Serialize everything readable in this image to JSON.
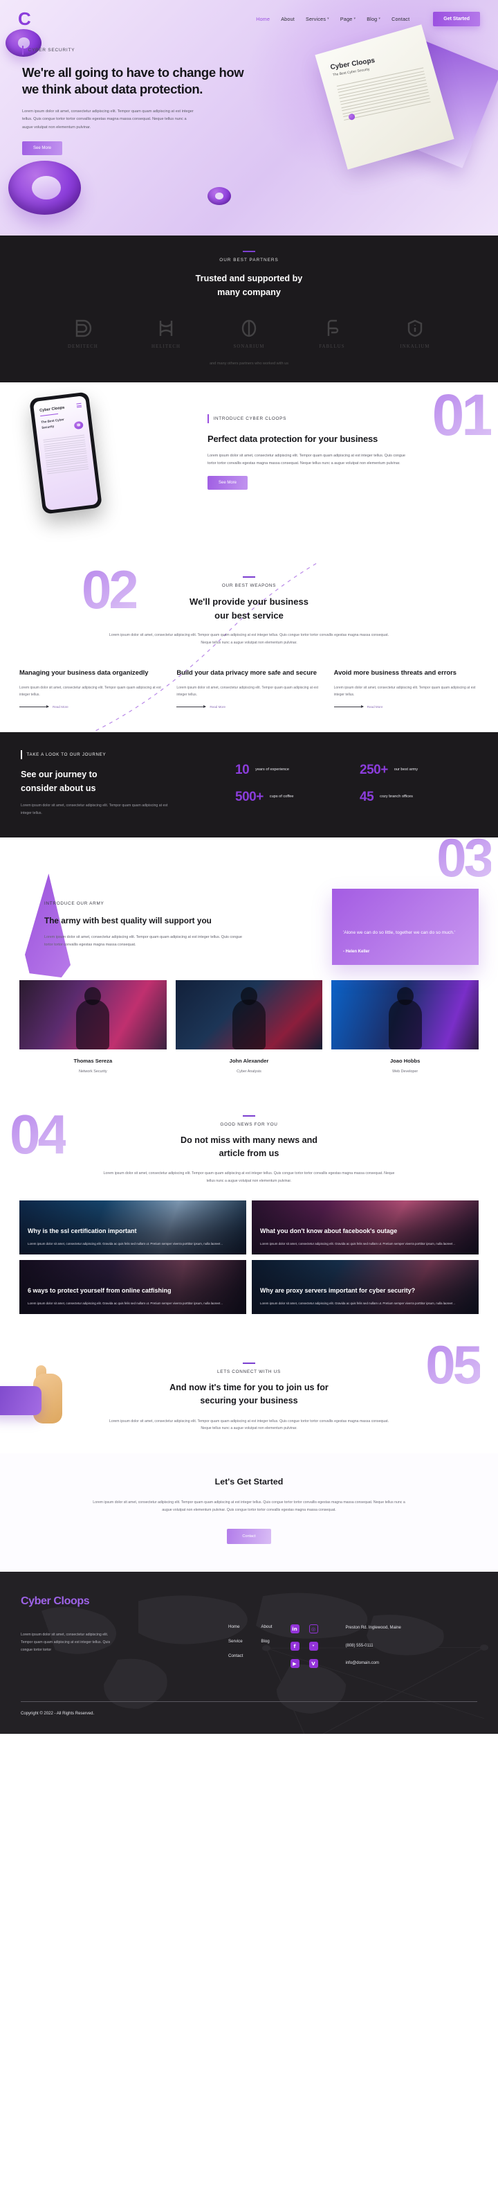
{
  "brand": {
    "name": "Cyber Cloops",
    "logo_glyph": "C"
  },
  "nav": {
    "items": [
      {
        "label": "Home",
        "active": true,
        "caret": ""
      },
      {
        "label": "About",
        "active": false,
        "caret": ""
      },
      {
        "label": "Services",
        "active": false,
        "caret": "▾"
      },
      {
        "label": "Page",
        "active": false,
        "caret": "▾"
      },
      {
        "label": "Blog",
        "active": false,
        "caret": "▾"
      },
      {
        "label": "Contact",
        "active": false,
        "caret": ""
      }
    ],
    "cta": "Get Started"
  },
  "hero": {
    "eyebrow": "CYBER SECURITY",
    "title": "We're all going to have to change how we think about data protection.",
    "paragraph": "Lorem ipsum dolor sit amet, consectetur adipiscing elit. Tempor quam quam adipiscing at est integer tellus. Quis congue tortor tortor convallis egestas magna massa consequat. Neque tellus nunc a augue volutpat non elementum pulvinar.",
    "button": "See More",
    "doc_title": "Cyber Cloops",
    "doc_sub": "The Best Cyber Security"
  },
  "partners": {
    "eyebrow": "OUR BEST PARTNERS",
    "title_line1": "Trusted and supported by",
    "title_line2": "many company",
    "note": "and many others partners who worked with us",
    "items": [
      {
        "name": "DEMITECH",
        "icon": "demitech-logo-icon"
      },
      {
        "name": "HELITECH",
        "icon": "helitech-logo-icon"
      },
      {
        "name": "SONARIUM",
        "icon": "sonarium-logo-icon"
      },
      {
        "name": "FABLLUS",
        "icon": "fabllus-logo-icon"
      },
      {
        "name": "INKALIUM",
        "icon": "inkalium-logo-icon"
      }
    ]
  },
  "section01": {
    "number": "01",
    "eyebrow": "INTRODUCE CYBER CLOOPS",
    "title": "Perfect data protection for your business",
    "paragraph": "Lorem ipsum dolor sit amet, consectetur adipiscing elit. Tempor quam quam adipiscing at est integer tellus. Quis congue tortor tortor convallis egestas magna massa consequat. Neque tellus nunc a augue volutpat non elementum pulvinar.",
    "button": "See More",
    "phone_logo": "Cyber Cloops",
    "phone_sub": "The Best Cyber Security"
  },
  "section02": {
    "number": "02",
    "eyebrow": "OUR BEST WEAPONS",
    "title_line1": "We'll provide your business",
    "title_line2": "our best service",
    "paragraph": "Lorem ipsum dolor sit amet, consectetur adipiscing elit. Tempor quam quam adipiscing at est integer tellus. Quis congue tortor tortor convallis egestas magna massa consequat. Neque tellus nunc a augue volutpat non elementum pulvinar.",
    "cards": [
      {
        "title": "Managing your business data organizedly",
        "body": "Lorem ipsum dolor sit amet, consectetur adipiscing elit. Tempor quam quam adipiscing at est integer tellus.",
        "link": "Read More"
      },
      {
        "title": "Build your data privacy more safe and secure",
        "body": "Lorem ipsum dolor sit amet, consectetur adipiscing elit. Tempor quam quam adipiscing at est integer tellus.",
        "link": "Read More"
      },
      {
        "title": "Avoid more business threats and errors",
        "body": "Lorem ipsum dolor sit amet, consectetur adipiscing elit. Tempor quam quam adipiscing at est integer tellus.",
        "link": "Read More"
      }
    ]
  },
  "stats": {
    "eyebrow": "TAKE A LOOK TO OUR JOURNEY",
    "title_line1": "See our journey to",
    "title_line2": "consider about us",
    "paragraph": "Lorem ipsum dolor sit amet, consectetur adipiscing elit. Tempor quam quam adipiscing at est integer tellus.",
    "items": [
      {
        "value": "10",
        "label": "years of experience"
      },
      {
        "value": "250+",
        "label": "our best army"
      },
      {
        "value": "500+",
        "label": "cups of coffee"
      },
      {
        "value": "45",
        "label": "cozy branch offices"
      }
    ]
  },
  "section03": {
    "number": "03",
    "eyebrow": "INTRODUCE OUR ARMY",
    "title": "The army with best quality will support you",
    "paragraph": "Lorem ipsum dolor sit amet, consectetur adipiscing elit. Tempor quam quam adipiscing at est integer tellus. Quis congue tortor tortor convallis egestas magna massa consequat.",
    "quote": "'Alone we can do so little, together we can do so much.'",
    "quote_author": "- Helen Keller",
    "team": [
      {
        "name": "Thomas Sereza",
        "role": "Network Security"
      },
      {
        "name": "John Alexander",
        "role": "Cyber Analysis"
      },
      {
        "name": "Joao Hobbs",
        "role": "Web Developer"
      }
    ]
  },
  "section04": {
    "number": "04",
    "eyebrow": "GOOD NEWS FOR YOU",
    "title_line1": "Do not miss with many news and",
    "title_line2": "article from us",
    "paragraph": "Lorem ipsum dolor sit amet, consectetur adipiscing elit. Tempor quam quam adipiscing at est integer tellus. Quis congue tortor tortor convallis egestas magna massa consequat. Neque tellus nunc a augue volutpat non elementum pulvinar.",
    "articles": [
      {
        "title": "Why is the ssl certification important",
        "excerpt": "Lorem ipsum dolor sit amet, consectetur adipiscing elit. Gravida ac quis felis sed nullam ut. Pretium semper viverra porttitor ipsum, nulla laoreet .."
      },
      {
        "title": "What you don't know about facebook's outage",
        "excerpt": "Lorem ipsum dolor sit amet, consectetur adipiscing elit. Gravida ac quis felis sed nullam ut. Pretium semper viverra porttitor ipsum, nulla laoreet .."
      },
      {
        "title": "6 ways to protect yourself from online catfishing",
        "excerpt": "Lorem ipsum dolor sit amet, consectetur adipiscing elit. Gravida ac quis felis sed nullam ut. Pretium semper viverra porttitor ipsum, nulla laoreet .."
      },
      {
        "title": "Why are proxy servers important for cyber security?",
        "excerpt": "Lorem ipsum dolor sit amet, consectetur adipiscing elit. Gravida ac quis felis sed nullam ut. Pretium semper viverra porttitor ipsum, nulla laoreet .."
      }
    ]
  },
  "section05": {
    "number": "05",
    "eyebrow": "LETS CONNECT WITH US",
    "title_line1": "And now it's time for you to join us for",
    "title_line2": "securing your business",
    "paragraph": "Lorem ipsum dolor sit amet, consectetur adipiscing elit. Tempor quam quam adipiscing at est integer tellus. Quis congue tortor tortor convallis egestas magna massa consequat. Neque tellus nunc a augue volutpat non elementum pulvinar."
  },
  "getstarted": {
    "title": "Let's Get Started",
    "paragraph": "Lorem ipsum dolor sit amet, consectetur adipiscing elit. Tempor quam quam adipiscing at est integer tellus. Quis congue tortor tortor convallis egestas magna massa consequat. Neque tellus nunc a augue volutpat non elementum pulvinar. Quis congue tortor tortor convallis egestas magna massa consequat.",
    "button": "Contact"
  },
  "footer": {
    "logo": "Cyber Cloops",
    "description": "Lorem ipsum dolor sit amet, consectetur adipiscing elit. Tempor quam quam adipiscing at est integer tellus. Quis congue tortor tortor",
    "links": [
      {
        "label": "Home"
      },
      {
        "label": "About"
      },
      {
        "label": "Service"
      },
      {
        "label": "Blog"
      },
      {
        "label": "Contact"
      }
    ],
    "social": [
      {
        "name": "linkedin-icon",
        "glyph": "in",
        "style": "solid"
      },
      {
        "name": "instagram-icon",
        "glyph": "◎",
        "style": "outline"
      },
      {
        "name": "facebook-icon",
        "glyph": "f",
        "style": "solid"
      },
      {
        "name": "twitter-icon",
        "glyph": "ᵛ",
        "style": "solid"
      },
      {
        "name": "youtube-icon",
        "glyph": "▶",
        "style": "solid"
      },
      {
        "name": "vimeo-icon",
        "glyph": "V",
        "style": "solid"
      }
    ],
    "address": "Preston Rd. Inglewood, Maine",
    "phone": "(808) 555-0111",
    "email": "info@domain.com",
    "copyright": "Copyright © 2022 - All Rights Reserved."
  },
  "colors": {
    "accent": "#9a4fe0",
    "accent_dark": "#8b3ddb",
    "dark_bg": "#1c1a1d",
    "footer_bg": "#232125",
    "light_purple": "#c9a6f0"
  }
}
